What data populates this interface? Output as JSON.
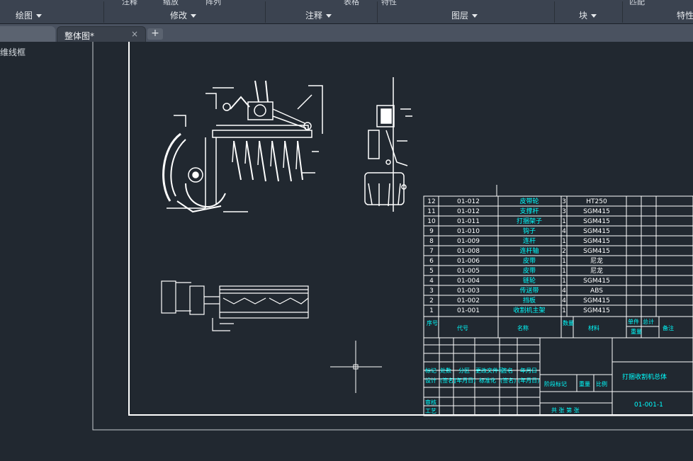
{
  "ribbon": {
    "top_labels": [
      "注释",
      "缩放",
      "阵列",
      "表格",
      "特性",
      "匹配"
    ],
    "panels": [
      {
        "label": "绘图"
      },
      {
        "label": "修改"
      },
      {
        "label": "注释"
      },
      {
        "label": "图层"
      },
      {
        "label": "块"
      },
      {
        "label": "特性"
      }
    ]
  },
  "tabs": {
    "active_label": "整体图*",
    "close_glyph": "×",
    "add_glyph": "+"
  },
  "sidebar": {
    "title": "二维线框"
  },
  "drawing": {
    "parts_table": {
      "rows": [
        [
          "12",
          "01-012",
          "皮带轮",
          "3",
          "HT250"
        ],
        [
          "11",
          "01-012",
          "支撑杆",
          "3",
          "SGM415"
        ],
        [
          "10",
          "01-011",
          "打捆架子",
          "1",
          "SGM415"
        ],
        [
          "9",
          "01-010",
          "钩子",
          "4",
          "SGM415"
        ],
        [
          "8",
          "01-009",
          "连杆",
          "1",
          "SGM415"
        ],
        [
          "7",
          "01-008",
          "连杆轴",
          "2",
          "SGM415"
        ],
        [
          "6",
          "01-006",
          "皮带",
          "1",
          "尼龙"
        ],
        [
          "5",
          "01-005",
          "皮带",
          "1",
          "尼龙"
        ],
        [
          "4",
          "01-004",
          "链轮",
          "1",
          "SGM415"
        ],
        [
          "3",
          "01-003",
          "传送带",
          "4",
          "ABS"
        ],
        [
          "2",
          "01-002",
          "挡板",
          "4",
          "SGM415"
        ],
        [
          "1",
          "01-001",
          "收割机主架",
          "1",
          "SGM415"
        ]
      ],
      "header": {
        "seq": "序号",
        "code": "代号",
        "name": "名称",
        "qty": "数量",
        "material": "材料",
        "unit": "单件",
        "total": "总计",
        "weight": "重量",
        "remark": "备注"
      }
    },
    "title_block": {
      "row_labels": [
        "标记",
        "处数",
        "分区",
        "更改文件号",
        "签名",
        "年月日"
      ],
      "row2_labels": [
        "设计",
        "(签名)",
        "(年月日)",
        "标准化",
        "(签名)",
        "(年月日)"
      ],
      "audit": "审核",
      "process": "工艺",
      "stage_mark": "阶段标记",
      "weight": "重量",
      "scale": "比例",
      "sheets": "共  张  第  张",
      "drawing_title": "打捆收割机总体",
      "drawing_number": "01-001-1"
    }
  }
}
